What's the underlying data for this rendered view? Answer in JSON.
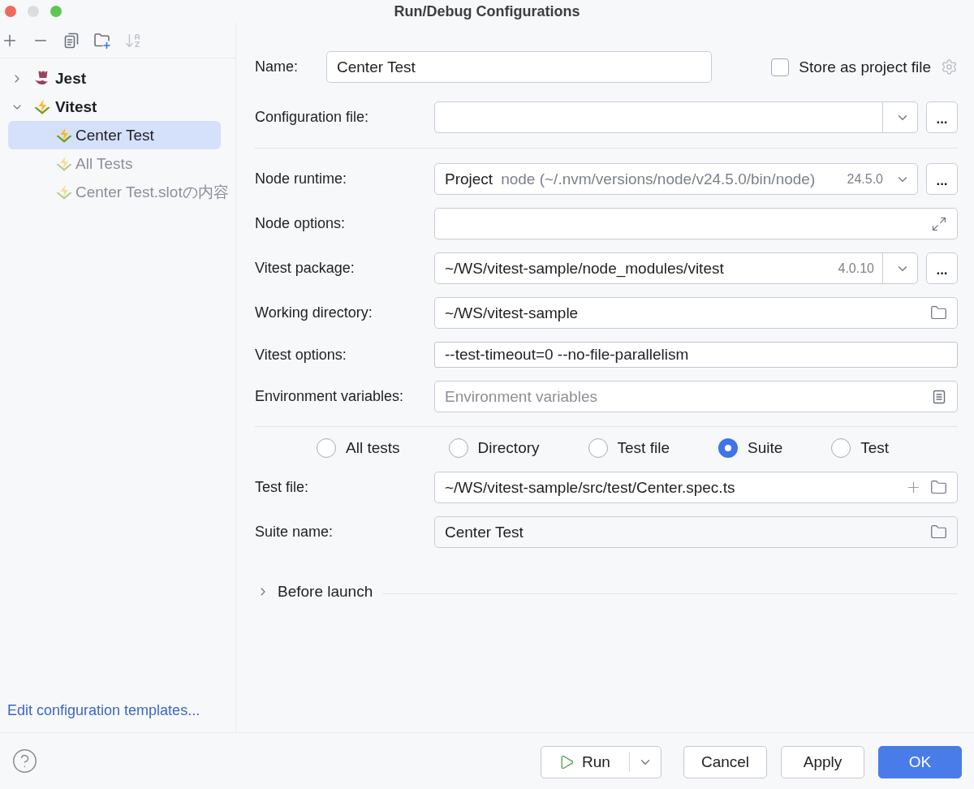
{
  "window": {
    "title": "Run/Debug Configurations",
    "controls": [
      {
        "kind": "close",
        "disabled": false
      },
      {
        "kind": "minimize",
        "disabled": true
      },
      {
        "kind": "zoom",
        "disabled": false
      }
    ]
  },
  "toolbar": [
    {
      "kind": "add",
      "disabled": false
    },
    {
      "kind": "remove",
      "disabled": false
    },
    {
      "kind": "copy",
      "disabled": false
    },
    {
      "kind": "new_folder",
      "disabled": false
    },
    {
      "kind": "sort",
      "disabled": true
    }
  ],
  "tree": [
    {
      "label": "Jest",
      "kind": "jest",
      "expanded": false,
      "selected": false
    },
    {
      "label": "Vitest",
      "kind": "vitest",
      "expanded": true,
      "selected": false,
      "children": [
        {
          "label": "Center Test",
          "kind": "vitest",
          "selected": true,
          "temporary": false
        },
        {
          "label": "All Tests",
          "kind": "vitest",
          "selected": false,
          "temporary": true
        },
        {
          "label": "Center Test.slotの内容",
          "kind": "vitest",
          "selected": false,
          "temporary": true
        }
      ]
    }
  ],
  "edit_templates_link": "Edit configuration templates...",
  "name_field": {
    "label": "Name:",
    "value": "Center Test"
  },
  "store_as_project_file": {
    "label": "Store as project file",
    "checked": false
  },
  "config_file": {
    "label": "Configuration file:",
    "browse": "..."
  },
  "fields": [
    {
      "kind": "runtime",
      "label": "Node runtime:",
      "value": "Project",
      "detail": "node (~/.nvm/versions/node/v24.5.0/bin/node)",
      "version": "24.5.0",
      "browse": "..."
    },
    {
      "kind": "expandable",
      "label": "Node options:"
    },
    {
      "kind": "package",
      "label": "Vitest package:",
      "value": "~/WS/vitest-sample/node_modules/vitest",
      "version": "4.0.10",
      "browse": "..."
    },
    {
      "kind": "directory",
      "label": "Working directory:",
      "value": "~/WS/vitest-sample"
    },
    {
      "kind": "text",
      "label": "Vitest options:",
      "value": "--test-timeout=0 --no-file-parallelism"
    },
    {
      "kind": "env",
      "label": "Environment variables:",
      "placeholder": "Environment variables"
    }
  ],
  "scope": [
    {
      "label": "All tests",
      "selected": false
    },
    {
      "label": "Directory",
      "selected": false
    },
    {
      "label": "Test file",
      "selected": false
    },
    {
      "label": "Suite",
      "selected": true
    },
    {
      "label": "Test",
      "selected": false
    }
  ],
  "target_fields": [
    {
      "kind": "file",
      "label": "Test file:",
      "value": "~/WS/vitest-sample/src/test/Center.spec.ts"
    },
    {
      "kind": "suite",
      "label": "Suite name:",
      "value": "Center Test"
    }
  ],
  "before_launch": {
    "label": "Before launch",
    "expanded": false
  },
  "footer": {
    "buttons": [
      {
        "kind": "split",
        "label": "Run"
      },
      {
        "kind": "plain",
        "label": "Cancel"
      },
      {
        "kind": "plain",
        "label": "Apply"
      },
      {
        "kind": "primary",
        "label": "OK"
      }
    ]
  }
}
